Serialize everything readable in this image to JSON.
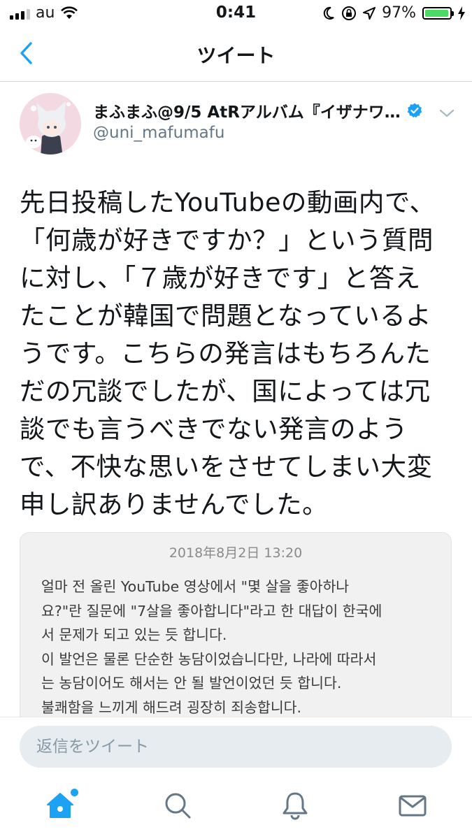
{
  "status_bar": {
    "carrier": "au",
    "time": "0:41",
    "battery_percent": "97%",
    "battery_level": 0.97,
    "icons": [
      "signal-icon",
      "wifi-icon",
      "moon-icon",
      "rotation-lock-icon",
      "location-icon",
      "battery-icon",
      "charging-icon"
    ]
  },
  "nav": {
    "title": "ツイート",
    "back_icon": "chevron-left-icon"
  },
  "tweet": {
    "display_name": "まふまふ@9/5 AtRアルバム『イザナワ…",
    "handle": "@uni_mafumafu",
    "verified": true,
    "text_lines": [
      "先日投稿したYouTubeの動画内で、",
      "「何歳が好きですか？」という質問",
      "に対し、「７歳が好きです」と答え",
      "たことが韓国で問題となっているよ",
      "うです。こちらの発言はもちろんた",
      "だの冗談でしたが、国によっては冗",
      "談でも言うべきでない発言のよう",
      "で、不快な思いをさせてしまい大変",
      "申し訳ありませんでした。"
    ],
    "image": {
      "date": "2018年8月2日 13:20",
      "lines": [
        "얼마 전 올린 YouTube 영상에서 \"몇 살을 좋아하나",
        "요?\"란 질문에 \"7살을 좋아합니다\"라고 한 대답이 한국에",
        "서 문제가 되고 있는 듯 합니다.",
        "이 발언은 물론 단순한 농담이었습니다만, 나라에 따라서",
        "는 농담이어도 해서는 안 될 발언이었던 듯 합니다.",
        "불쾌함을 느끼게 해드려 굉장히 죄송합니다."
      ]
    }
  },
  "reply": {
    "placeholder": "返信をツイート"
  },
  "tabbar": {
    "tabs": [
      "home-icon",
      "search-icon",
      "notifications-icon",
      "messages-icon"
    ],
    "active": "home-icon"
  },
  "colors": {
    "accent": "#1da1f2",
    "text": "#14171a",
    "secondary": "#657786",
    "battery": "#4cd964"
  }
}
